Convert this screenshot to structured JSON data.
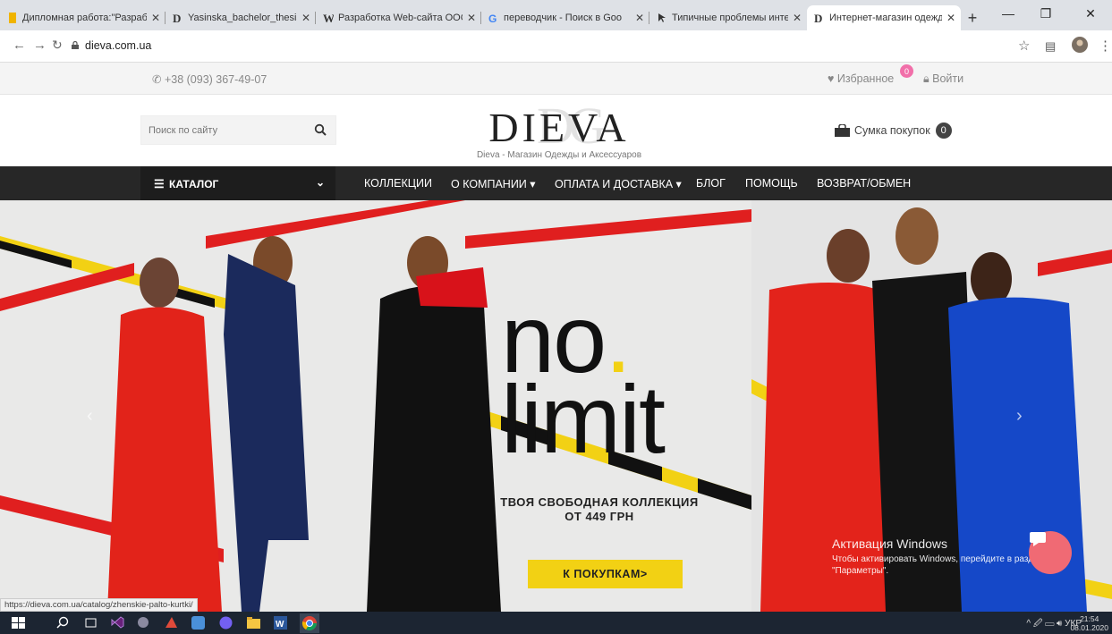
{
  "browser": {
    "tabs": [
      {
        "label": "Дипломная работа:\"Разраб",
        "icon": "document-icon"
      },
      {
        "label": "Yasinska_bachelor_thesis.pdf",
        "icon": "d-logo-icon"
      },
      {
        "label": "Разработка Web-сайта ООС",
        "icon": "w-icon"
      },
      {
        "label": "переводчик - Поиск в Goo",
        "icon": "google-icon"
      },
      {
        "label": "Типичные проблемы интер",
        "icon": "cursor-icon"
      },
      {
        "label": "Интернет-магазин одежды",
        "icon": "d-logo-icon",
        "active": true
      }
    ],
    "close_glyph": "✕",
    "new_tab_glyph": "+",
    "url": "dieva.com.ua",
    "status_url": "https://dieva.com.ua/catalog/zhenskie-palto-kurtki/"
  },
  "site": {
    "phone": "+38 (093) 367-49-07",
    "favorites_label": "Избранное",
    "favorites_count": "0",
    "login_label": "Войти",
    "search_placeholder": "Поиск по сайту",
    "logo_text": "DIEVA",
    "logo_monogram": "DG",
    "logo_subtitle": "Dieva - Магазин Одежды и Аксессуаров",
    "bag_label": "Сумка покупок",
    "bag_count": "0",
    "catalog_label": "КАТАЛОГ",
    "menu": [
      "КОЛЛЕКЦИИ",
      "О КОМПАНИИ ▾",
      "ОПЛАТА И ДОСТАВКА ▾",
      "БЛОГ",
      "ПОМОЩЬ",
      "ВОЗВРАТ/ОБМЕН"
    ]
  },
  "hero": {
    "headline_line1": "no",
    "headline_dot": ".",
    "headline_line2": "limit",
    "tagline_line1": "ТВОЯ СВОБОДНАЯ КОЛЛЕКЦИЯ",
    "tagline_line2": "ОТ 449 ГРН",
    "cta": "К ПОКУПКАМ>",
    "accent_color": "#f2d114",
    "slider_left_arrow": "‹",
    "slider_right_arrow": "›"
  },
  "overlay": {
    "activation_title": "Активация Windows",
    "activation_text_line1": "Чтобы активировать Windows, перейдите в раздел",
    "activation_text_line2": "\"Параметры\"."
  },
  "taskbar": {
    "lang": "УКР",
    "time": "21:54",
    "date": "08.01.2020"
  }
}
